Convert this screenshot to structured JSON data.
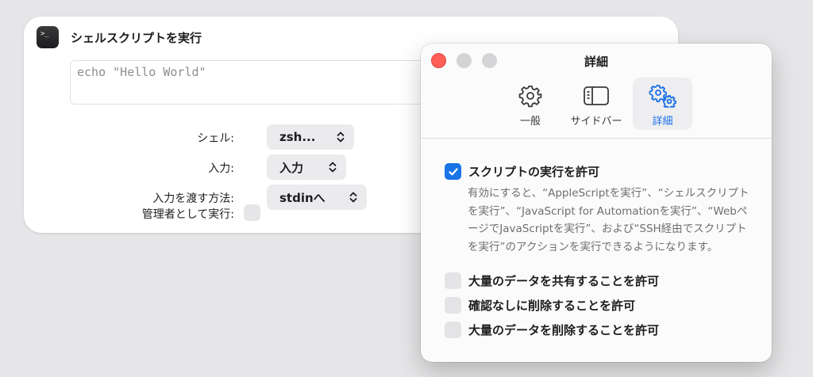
{
  "action": {
    "title": "シェルスクリプトを実行",
    "icon": "terminal-icon",
    "icon_glyph": ">_",
    "script_text": "echo \"Hello World\"",
    "fields": [
      {
        "label": "シェル:",
        "value": "zsh..."
      },
      {
        "label": "入力:",
        "value": "入力"
      },
      {
        "label": "入力を渡す方法:",
        "value": "stdinへ"
      },
      {
        "label": "管理者として実行:",
        "checked": false
      }
    ]
  },
  "detail_window": {
    "title": "詳細",
    "tabs": [
      {
        "label": "一般",
        "icon": "gear-icon",
        "selected": false
      },
      {
        "label": "サイドバー",
        "icon": "sidebar-icon",
        "selected": false
      },
      {
        "label": "詳細",
        "icon": "gears-icon",
        "selected": true
      }
    ],
    "options": [
      {
        "label": "スクリプトの実行を許可",
        "checked": true,
        "description": "有効にすると、“AppleScriptを実行”、“シェルスクリプトを実行”、“JavaScript for Automationを実行”、“WebページでJavaScriptを実行”、および“SSH経由でスクリプトを実行”のアクションを実行できるようになります。"
      },
      {
        "label": "大量のデータを共有することを許可",
        "checked": false
      },
      {
        "label": "確認なしに削除することを許可",
        "checked": false
      },
      {
        "label": "大量のデータを削除することを許可",
        "checked": false
      }
    ],
    "colors": {
      "accent": "#1a74e8",
      "close_button": "#ff5f57"
    }
  }
}
